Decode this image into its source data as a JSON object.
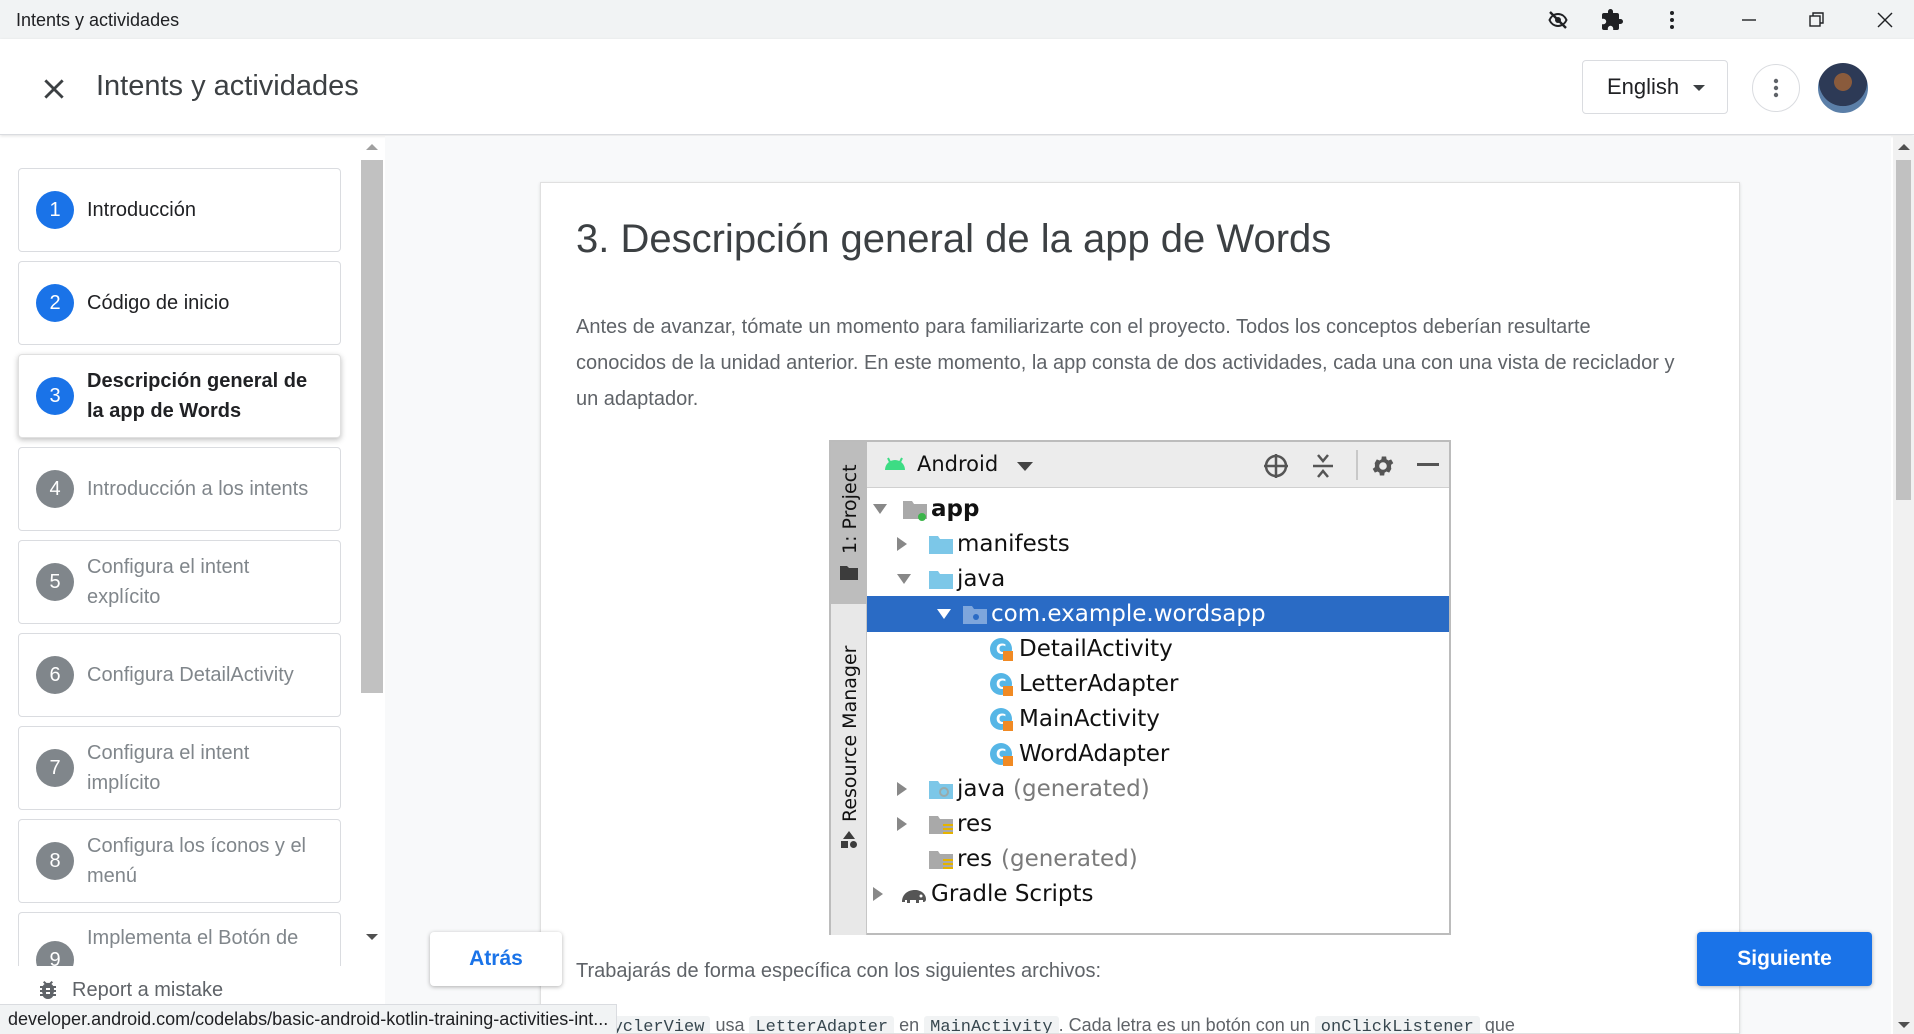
{
  "window": {
    "title": "Intents y actividades"
  },
  "header": {
    "title": "Intents y actividades",
    "language": "English"
  },
  "sidebar": {
    "steps": [
      {
        "num": "1",
        "label": "Introducción",
        "state": "done"
      },
      {
        "num": "2",
        "label": "Código de inicio",
        "state": "done"
      },
      {
        "num": "3",
        "label": "Descripción general de la app de Words",
        "state": "active"
      },
      {
        "num": "4",
        "label": "Introducción a los intents",
        "state": "todo"
      },
      {
        "num": "5",
        "label": "Configura el intent explícito",
        "state": "todo"
      },
      {
        "num": "6",
        "label": "Configura DetailActivity",
        "state": "todo"
      },
      {
        "num": "7",
        "label": "Configura el intent implícito",
        "state": "todo"
      },
      {
        "num": "8",
        "label": "Configura los íconos y el menú",
        "state": "todo"
      },
      {
        "num": "9",
        "label": "Implementa el Botón de",
        "state": "todo"
      }
    ],
    "report": "Report a mistake"
  },
  "content": {
    "heading": "3. Descripción general de la app de Words",
    "intro": "Antes de avanzar, tómate un momento para familiarizarte con el proyecto. Todos los conceptos deberían resultarte conocidos de la unidad anterior. En este momento, la app consta de dos actividades, cada una con una vista de reciclador y un adaptador.",
    "files_intro": "Trabajarás de forma específica con los siguientes archivos:",
    "code_line": {
      "c1": "RecyclerView",
      "t1": "usa",
      "c2": "LetterAdapter",
      "t2": "en",
      "c3": "MainActivity",
      "t3": ". Cada letra es un botón con un",
      "c4": "onClickListener",
      "t4": "que"
    }
  },
  "ide": {
    "side_project": "1: Project",
    "side_resource": "Resource Manager",
    "view_label": "Android",
    "tree": {
      "app": "app",
      "manifests": "manifests",
      "java": "java",
      "package": "com.example.wordsapp",
      "classes": [
        "DetailActivity",
        "LetterAdapter",
        "MainActivity",
        "WordAdapter"
      ],
      "java_gen": "java",
      "java_gen_suffix": "(generated)",
      "res": "res",
      "res_gen": "res",
      "res_gen_suffix": "(generated)",
      "gradle": "Gradle Scripts"
    }
  },
  "nav": {
    "back": "Atrás",
    "next": "Siguiente"
  },
  "status_url": "developer.android.com/codelabs/basic-android-kotlin-training-activities-int...",
  "colors": {
    "accent": "#1a73e8",
    "ide_selection": "#2a6bc5",
    "folder": "#7cc7e8"
  }
}
